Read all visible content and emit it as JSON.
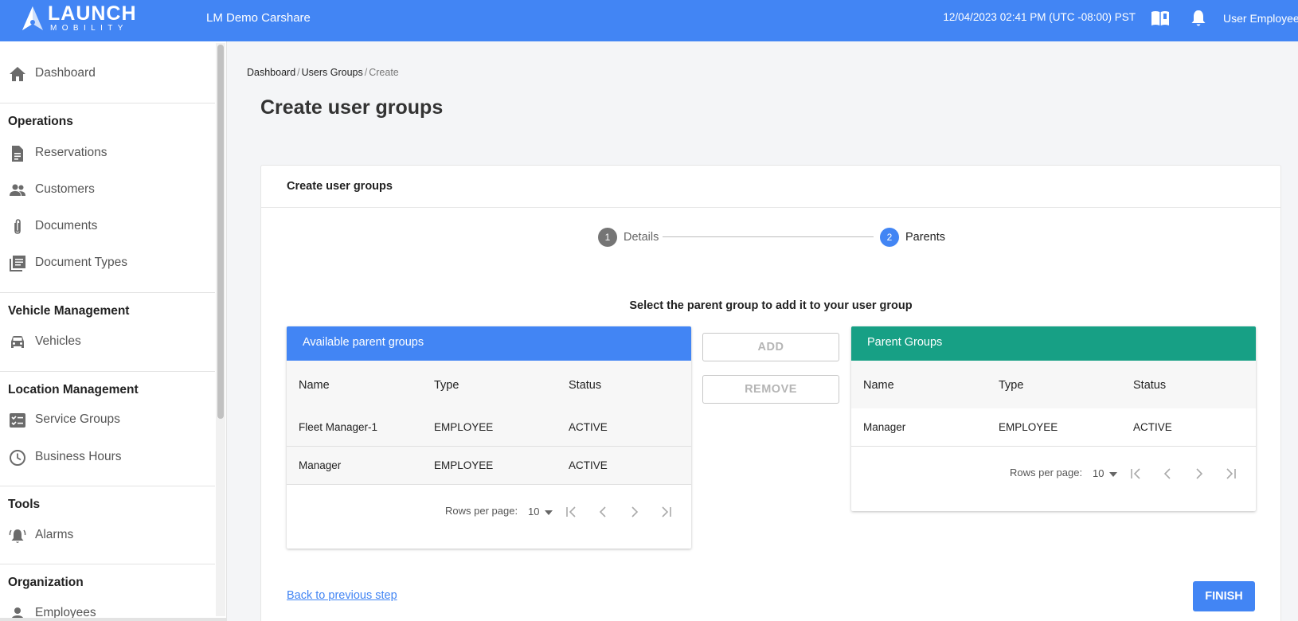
{
  "header": {
    "logo_word": "LAUNCH",
    "logo_sub": "MOBILITY",
    "tenant": "LM Demo Carshare",
    "datetime": "12/04/2023 02:41 PM (UTC -08:00) PST",
    "user": "User Employee",
    "icons": [
      "book-icon",
      "bell-icon"
    ]
  },
  "sidebar": {
    "dashboard": {
      "label": "Dashboard",
      "icon": "home-icon"
    },
    "sections": [
      {
        "title": "Operations",
        "items": [
          {
            "label": "Reservations",
            "icon": "document-icon"
          },
          {
            "label": "Customers",
            "icon": "people-icon"
          },
          {
            "label": "Documents",
            "icon": "paperclip-icon"
          },
          {
            "label": "Document Types",
            "icon": "library-icon"
          }
        ]
      },
      {
        "title": "Vehicle Management",
        "items": [
          {
            "label": "Vehicles",
            "icon": "car-icon"
          }
        ]
      },
      {
        "title": "Location Management",
        "items": [
          {
            "label": "Service Groups",
            "icon": "checklist-icon"
          },
          {
            "label": "Business Hours",
            "icon": "clock-icon"
          }
        ]
      },
      {
        "title": "Tools",
        "items": [
          {
            "label": "Alarms",
            "icon": "alarm-bell-icon"
          }
        ]
      },
      {
        "title": "Organization",
        "items": [
          {
            "label": "Employees",
            "icon": "person-icon"
          }
        ]
      }
    ]
  },
  "breadcrumb": {
    "items": [
      "Dashboard",
      "Users Groups"
    ],
    "current": "Create",
    "separator": "/"
  },
  "page_title": "Create user groups",
  "card": {
    "title": "Create user groups",
    "steps": [
      {
        "number": "1",
        "label": "Details",
        "state": "completed"
      },
      {
        "number": "2",
        "label": "Parents",
        "state": "active"
      }
    ],
    "instruction": "Select the parent group to add it to your user group",
    "available": {
      "title": "Available parent groups",
      "columns": [
        "Name",
        "Type",
        "Status"
      ],
      "rows": [
        [
          "Fleet Manager-1",
          "EMPLOYEE",
          "ACTIVE"
        ],
        [
          "Manager",
          "EMPLOYEE",
          "ACTIVE"
        ]
      ],
      "rows_per_page_label": "Rows per page:",
      "rows_per_page": "10"
    },
    "add_label": "ADD",
    "remove_label": "REMOVE",
    "parents": {
      "title": "Parent Groups",
      "columns": [
        "Name",
        "Type",
        "Status"
      ],
      "rows": [
        [
          "Manager",
          "EMPLOYEE",
          "ACTIVE"
        ]
      ],
      "rows_per_page_label": "Rows per page:",
      "rows_per_page": "10"
    },
    "back_label": "Back to previous step",
    "finish_label": "FINISH"
  },
  "colors": {
    "primary": "#4285f4",
    "teal": "#17a085",
    "step_done": "#757575"
  }
}
